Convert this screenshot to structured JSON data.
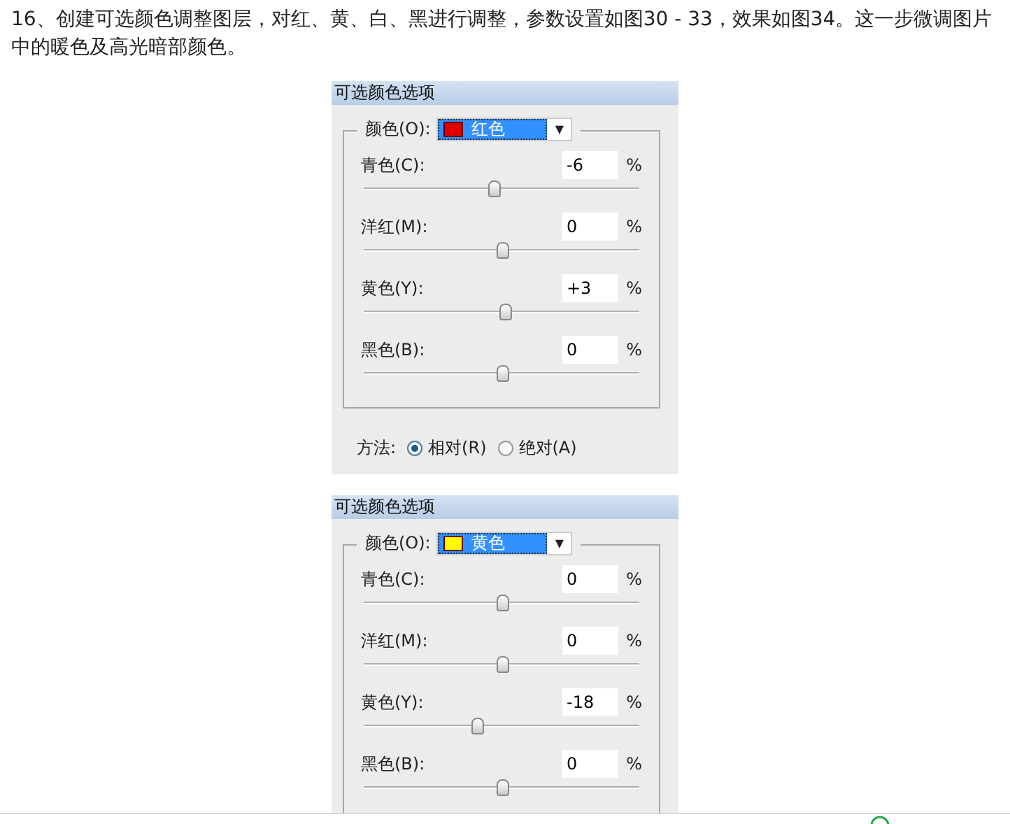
{
  "paragraph": "16、创建可选颜色调整图层，对红、黄、白、黑进行调整，参数设置如图30 - 33，效果如图34。这一步微调图片中的暖色及高光暗部颜色。",
  "dialogs": [
    {
      "title": "可选颜色选项",
      "color_label": "颜色(O):",
      "color_value": "红色",
      "color": "#e00000",
      "dropdown_arrow": "▼",
      "sliders": [
        {
          "label": "青色(C):",
          "value": "-6",
          "unit": "%",
          "level": 0.47
        },
        {
          "label": "洋红(M):",
          "value": "0",
          "unit": "%",
          "level": 0.5
        },
        {
          "label": "黄色(Y):",
          "value": "+3",
          "unit": "%",
          "level": 0.515
        },
        {
          "label": "黑色(B):",
          "value": "0",
          "unit": "%",
          "level": 0.5
        }
      ],
      "method": {
        "label": "方法:",
        "options": [
          {
            "label": "相对(R)",
            "selected": true
          },
          {
            "label": "绝对(A)",
            "selected": false
          }
        ]
      }
    },
    {
      "title": "可选颜色选项",
      "color_label": "颜色(O):",
      "color_value": "黄色",
      "color": "#ffff00",
      "dropdown_arrow": "▼",
      "sliders": [
        {
          "label": "青色(C):",
          "value": "0",
          "unit": "%",
          "level": 0.5
        },
        {
          "label": "洋红(M):",
          "value": "0",
          "unit": "%",
          "level": 0.5
        },
        {
          "label": "黄色(Y):",
          "value": "-18",
          "unit": "%",
          "level": 0.41
        },
        {
          "label": "黑色(B):",
          "value": "0",
          "unit": "%",
          "level": 0.5
        }
      ]
    }
  ]
}
